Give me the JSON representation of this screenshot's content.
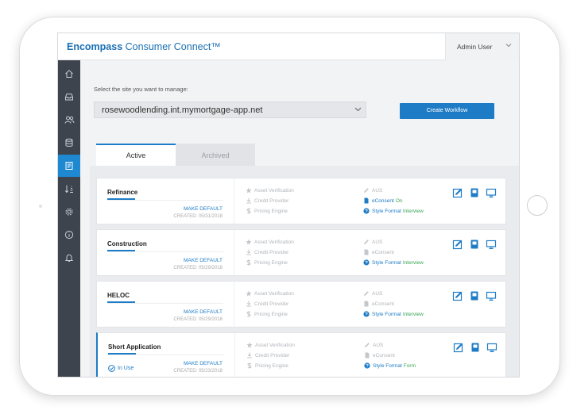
{
  "app": {
    "brand_bold": "Encompass",
    "brand_rest": " Consumer Connect™",
    "user_name": "Admin User"
  },
  "sidebar": {
    "items": [
      {
        "icon": "home-icon"
      },
      {
        "icon": "inbox-icon"
      },
      {
        "icon": "users-icon"
      },
      {
        "icon": "database-icon"
      },
      {
        "icon": "workflow-icon",
        "active": true
      },
      {
        "icon": "sort-icon"
      },
      {
        "icon": "settings-cog-icon"
      },
      {
        "icon": "info-icon"
      },
      {
        "icon": "bell-icon"
      }
    ]
  },
  "main": {
    "site_label": "Select the site you want to manage:",
    "site_value": "rosewoodlending.int.mymortgage-app.net",
    "create_button": "Create Workflow",
    "tabs": {
      "active": "Active",
      "archived": "Archived"
    }
  },
  "labels": {
    "make_default": "MAKE DEFAULT",
    "asset": "Asset Verification",
    "credit": "Credit Provider",
    "pricing": "Pricing Engine",
    "aus": "AUS",
    "econsent": "eConsent",
    "style_format": "Style Format",
    "in_use": "In Use"
  },
  "workflows": [
    {
      "title": "Refinance",
      "created": "CREATED: 05/31/2018",
      "econsent_on": "On",
      "style": "Interview",
      "in_use": false
    },
    {
      "title": "Construction",
      "created": "CREATED: 05/29/2018",
      "econsent_on": "",
      "style": "Interview",
      "in_use": false
    },
    {
      "title": "HELOC",
      "created": "CREATED: 05/29/2018",
      "econsent_on": "",
      "style": "Interview",
      "in_use": false
    },
    {
      "title": "Short Application",
      "created": "CREATED: 05/23/2018",
      "econsent_on": "",
      "style": "Form",
      "in_use": true
    }
  ],
  "colors": {
    "accent": "#1e7cc6",
    "sidebar": "#3d444d",
    "sidebar_active": "#1e88d0",
    "green": "#3aa655"
  }
}
